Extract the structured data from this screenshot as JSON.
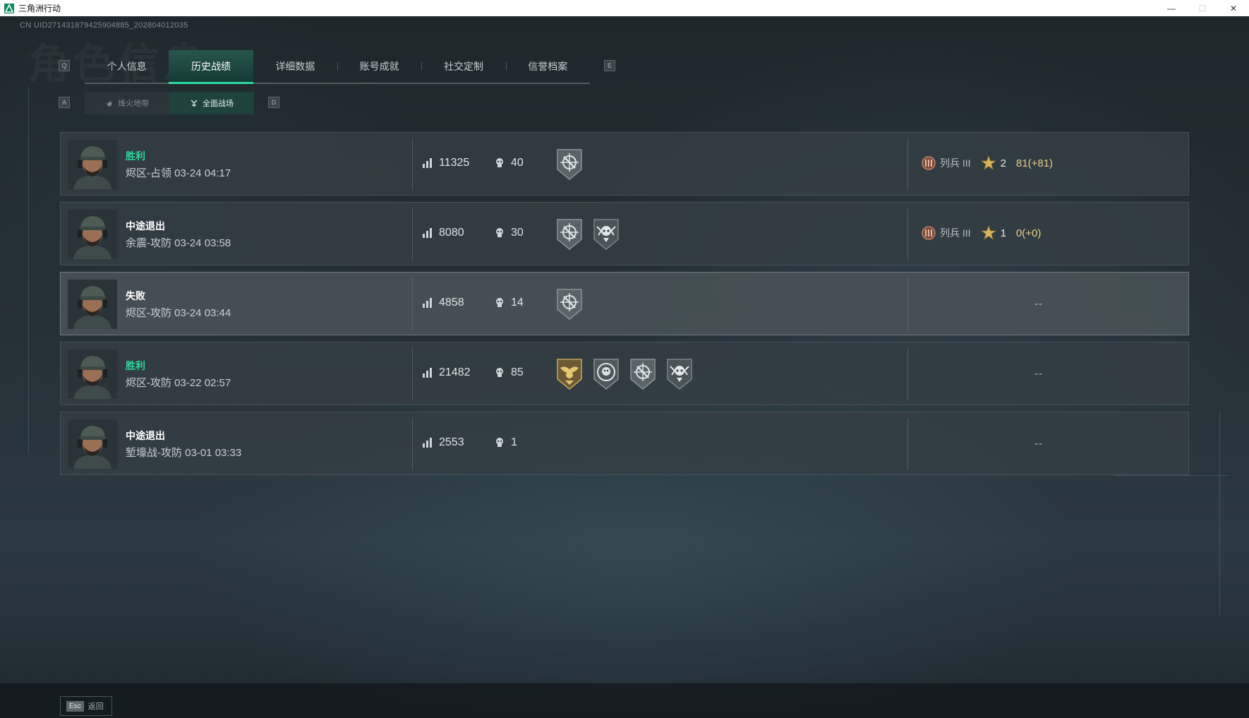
{
  "window": {
    "title": "三角洲行动",
    "minimize": "—",
    "maximize": "☐",
    "close": "✕"
  },
  "header": {
    "uid": "CN UID2714318794259048​85_202804012035",
    "watermark": "角色信息",
    "tab_prev_key": "Q",
    "tab_next_key": "E",
    "subtab_prev_key": "A",
    "subtab_next_key": "D"
  },
  "tabs": [
    {
      "label": "个人信息",
      "active": false
    },
    {
      "label": "历史战绩",
      "active": true
    },
    {
      "label": "详细数据",
      "active": false
    },
    {
      "label": "账号成就",
      "active": false
    },
    {
      "label": "社交定制",
      "active": false
    },
    {
      "label": "信誉档案",
      "active": false
    }
  ],
  "subtabs": [
    {
      "label": "烽火地带",
      "active": false,
      "icon": "flame-zone-icon"
    },
    {
      "label": "全面战场",
      "active": true,
      "icon": "battlefield-icon"
    }
  ],
  "matches": [
    {
      "outcome": "胜利",
      "outcome_type": "win",
      "info": "烬区-占领 03-24 04:17",
      "score": "11325",
      "kills": "40",
      "badges": [
        "crosshair-badge"
      ],
      "rank": "列兵 III",
      "level": "2",
      "points": "81(+81)",
      "placeholder": ""
    },
    {
      "outcome": "中途退出",
      "outcome_type": "quit",
      "info": "余震-攻防 03-24 03:58",
      "score": "8080",
      "kills": "30",
      "badges": [
        "crosshair-badge",
        "skull-wing-badge"
      ],
      "rank": "列兵 III",
      "level": "1",
      "points": "0(+0)",
      "placeholder": ""
    },
    {
      "outcome": "失败",
      "outcome_type": "loss",
      "info": "烬区-攻防 03-24 03:44",
      "score": "4858",
      "kills": "14",
      "badges": [
        "crosshair-badge"
      ],
      "rank": "",
      "level": "",
      "points": "",
      "placeholder": "--"
    },
    {
      "outcome": "胜利",
      "outcome_type": "win",
      "info": "烬区-攻防 03-22 02:57",
      "score": "21482",
      "kills": "85",
      "badges": [
        "gold-eagle-badge",
        "skull-ring-badge",
        "crosshair-badge",
        "skull-wing-badge"
      ],
      "rank": "",
      "level": "",
      "points": "",
      "placeholder": "--"
    },
    {
      "outcome": "中途退出",
      "outcome_type": "quit",
      "info": "堑壕战-攻防 03-01 03:33",
      "score": "2553",
      "kills": "1",
      "badges": [],
      "rank": "",
      "level": "",
      "points": "",
      "placeholder": "--"
    }
  ],
  "footer": {
    "esc_key": "Esc",
    "back_label": "返回"
  },
  "colors": {
    "accent_green": "#2fd79b",
    "points_gold": "#e9cf8a"
  }
}
